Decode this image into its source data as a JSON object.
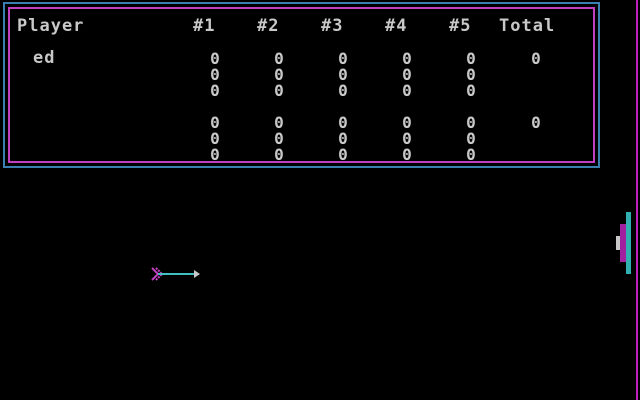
{
  "scoreboard": {
    "headers": {
      "player": "Player",
      "c1": "#1",
      "c2": "#2",
      "c3": "#3",
      "c4": "#4",
      "c5": "#5",
      "total": "Total"
    },
    "rows": [
      {
        "name": "ed",
        "scores": [
          [
            "0",
            "0",
            "0"
          ],
          [
            "0",
            "0",
            "0"
          ],
          [
            "0",
            "0",
            "0"
          ],
          [
            "0",
            "0",
            "0"
          ],
          [
            "0",
            "0",
            "0"
          ]
        ],
        "total": "0"
      },
      {
        "name": "",
        "scores": [
          [
            "0",
            "0",
            "0"
          ],
          [
            "0",
            "0",
            "0"
          ],
          [
            "0",
            "0",
            "0"
          ],
          [
            "0",
            "0",
            "0"
          ],
          [
            "0",
            "0",
            "0"
          ]
        ],
        "total": "0"
      }
    ]
  },
  "colors": {
    "border_outer": "#3a7fb0",
    "border_inner": "#c040c0",
    "text": "#c8c8c8",
    "arrow_shaft": "#40c0c0",
    "arrow_fletching": "#c040c0",
    "target_stand": "#30b0b0",
    "target_face": "#a020a0"
  }
}
